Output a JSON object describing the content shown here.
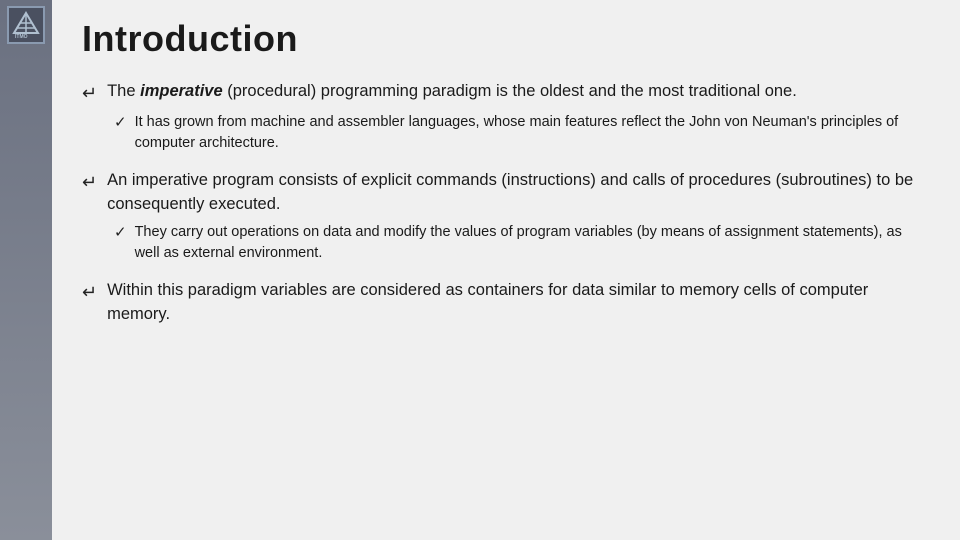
{
  "page": {
    "title": "Introduction"
  },
  "sidebar": {
    "logo_alt": "ITMO logo"
  },
  "content": {
    "bullets": [
      {
        "id": "bullet1",
        "symbol": "Æ",
        "text_parts": [
          {
            "type": "text",
            "content": "The "
          },
          {
            "type": "em",
            "content": "imperative"
          },
          {
            "type": "text",
            "content": " (procedural) programming paradigm is the oldest and the most traditional one."
          }
        ],
        "sub_bullets": [
          {
            "id": "sub1a",
            "symbol": "ü",
            "text": "It has grown from machine and assembler languages, whose main features reflect the John von Neuman's principles of computer architecture."
          }
        ]
      },
      {
        "id": "bullet2",
        "symbol": "Æ",
        "text_parts": [
          {
            "type": "text",
            "content": "An imperative program consists of explicit commands (instructions) and calls of procedures (subroutines) to be consequently executed."
          }
        ],
        "sub_bullets": [
          {
            "id": "sub2a",
            "symbol": "ü",
            "text": "They carry out operations on data and modify the values of program variables (by means of assignment statements), as well as external environment."
          }
        ]
      },
      {
        "id": "bullet3",
        "symbol": "Æ",
        "text_parts": [
          {
            "type": "text",
            "content": "Within this paradigm variables are considered as containers for data similar to memory cells of computer memory."
          }
        ],
        "sub_bullets": []
      }
    ]
  }
}
